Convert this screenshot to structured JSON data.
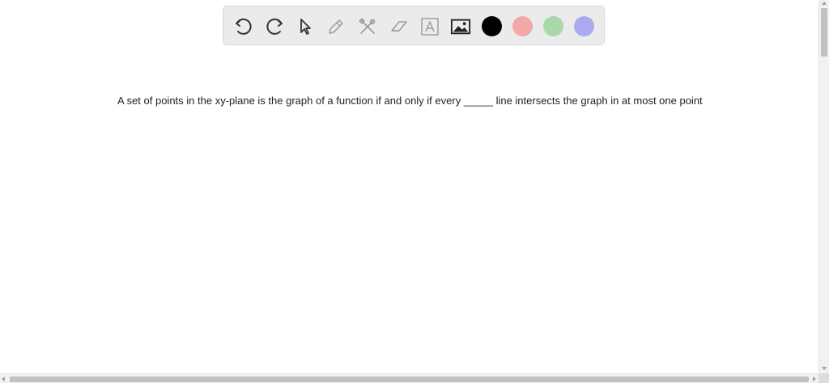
{
  "toolbar": {
    "tools": [
      {
        "icon": "undo-icon"
      },
      {
        "icon": "redo-icon"
      },
      {
        "icon": "pointer-icon"
      },
      {
        "icon": "pencil-icon"
      },
      {
        "icon": "tools-icon"
      },
      {
        "icon": "eraser-icon"
      },
      {
        "icon": "text-icon"
      },
      {
        "icon": "image-icon"
      }
    ],
    "colors": [
      "#000000",
      "#f2a7a9",
      "#a9d8a9",
      "#aaaaf0"
    ]
  },
  "question": {
    "text": "A set of points in the xy-plane is the graph of a function if and only if every _____ line intersects the graph in at most one point"
  }
}
